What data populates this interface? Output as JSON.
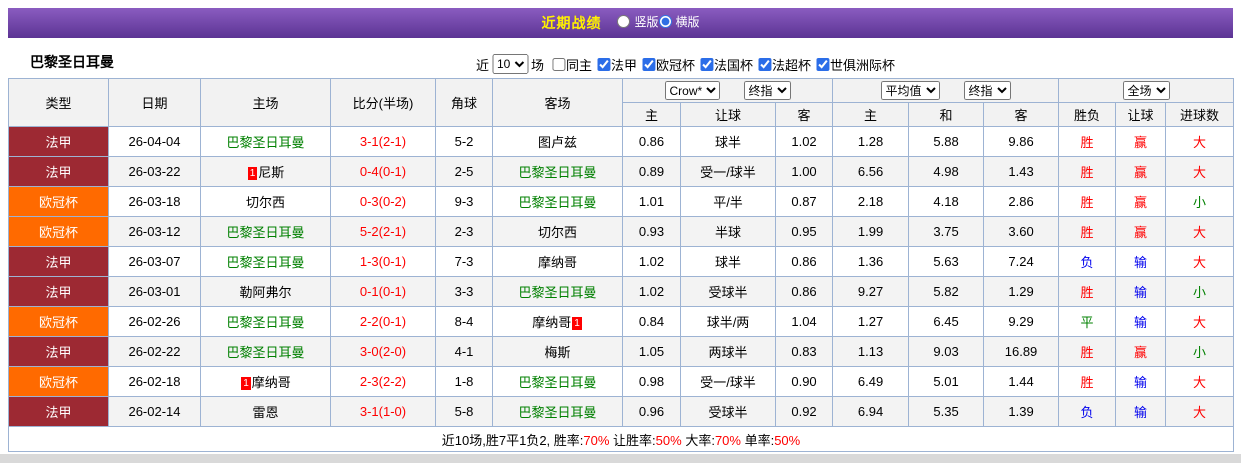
{
  "colors": {
    "title_bar_purple": "#6a3fa0",
    "title_text_yellow": "#fff100",
    "ligue1_red": "#9d2933",
    "ucl_orange": "#ff6a00",
    "psg_green": "#008000",
    "win_red": "#ff0000",
    "lose_blue": "#0000ee",
    "draw_green": "#008000",
    "table_border_blue": "#9db3d3"
  },
  "title_bar": {
    "title": "近期战绩",
    "layout_options": [
      {
        "key": "vertical",
        "label": "竖版",
        "selected": false
      },
      {
        "key": "horizontal",
        "label": "横版",
        "selected": true
      }
    ]
  },
  "filter_bar": {
    "team_name": "巴黎圣日耳曼",
    "near_label": "近",
    "match_count": "10",
    "matches_label": "场",
    "checkboxes": [
      {
        "key": "same-home",
        "label": "同主",
        "checked": false
      },
      {
        "key": "ligue1",
        "label": "法甲",
        "checked": true
      },
      {
        "key": "ucl",
        "label": "欧冠杯",
        "checked": true
      },
      {
        "key": "coupe-de-france",
        "label": "法国杯",
        "checked": true
      },
      {
        "key": "trophee",
        "label": "法超杯",
        "checked": true
      },
      {
        "key": "club-world-cup",
        "label": "世俱洲际杯",
        "checked": true
      }
    ]
  },
  "table": {
    "main_headers": [
      "类型",
      "日期",
      "主场",
      "比分(半场)",
      "角球",
      "客场"
    ],
    "sub_headers": [
      "主",
      "让球",
      "客",
      "主",
      "和",
      "客",
      "胜负",
      "让球",
      "进球数"
    ],
    "selects": {
      "odds_source": "Crow*",
      "odds_time": "终指",
      "avg_source": "平均值",
      "avg_time": "终指",
      "result_scope": "全场"
    },
    "redcard_label": "1",
    "rows": [
      {
        "league": "法甲",
        "league_type": "ligue1",
        "date": "26-04-04",
        "home": {
          "name": "巴黎圣日耳曼",
          "psg": true
        },
        "score": "3-1(2-1)",
        "corners": "5-2",
        "away": {
          "name": "图卢兹",
          "psg": false
        },
        "crown_home": "0.86",
        "crown_hcap": "球半",
        "crown_away": "1.02",
        "avg_home": "1.28",
        "avg_draw": "5.88",
        "avg_away": "9.86",
        "wdl": {
          "t": "胜",
          "c": "red"
        },
        "hcap_res": {
          "t": "赢",
          "c": "red"
        },
        "goals": {
          "t": "大",
          "c": "red"
        }
      },
      {
        "league": "法甲",
        "league_type": "ligue1",
        "date": "26-03-22",
        "home": {
          "name": "尼斯",
          "psg": false,
          "redcard": "before"
        },
        "score": "0-4(0-1)",
        "corners": "2-5",
        "away": {
          "name": "巴黎圣日耳曼",
          "psg": true
        },
        "crown_home": "0.89",
        "crown_hcap": "受一/球半",
        "crown_away": "1.00",
        "avg_home": "6.56",
        "avg_draw": "4.98",
        "avg_away": "1.43",
        "wdl": {
          "t": "胜",
          "c": "red"
        },
        "hcap_res": {
          "t": "赢",
          "c": "red"
        },
        "goals": {
          "t": "大",
          "c": "red"
        }
      },
      {
        "league": "欧冠杯",
        "league_type": "ucl",
        "date": "26-03-18",
        "home": {
          "name": "切尔西",
          "psg": false
        },
        "score": "0-3(0-2)",
        "corners": "9-3",
        "away": {
          "name": "巴黎圣日耳曼",
          "psg": true
        },
        "crown_home": "1.01",
        "crown_hcap": "平/半",
        "crown_away": "0.87",
        "avg_home": "2.18",
        "avg_draw": "4.18",
        "avg_away": "2.86",
        "wdl": {
          "t": "胜",
          "c": "red"
        },
        "hcap_res": {
          "t": "赢",
          "c": "red"
        },
        "goals": {
          "t": "小",
          "c": "green"
        }
      },
      {
        "league": "欧冠杯",
        "league_type": "ucl",
        "date": "26-03-12",
        "home": {
          "name": "巴黎圣日耳曼",
          "psg": true
        },
        "score": "5-2(2-1)",
        "corners": "2-3",
        "away": {
          "name": "切尔西",
          "psg": false
        },
        "crown_home": "0.93",
        "crown_hcap": "半球",
        "crown_away": "0.95",
        "avg_home": "1.99",
        "avg_draw": "3.75",
        "avg_away": "3.60",
        "wdl": {
          "t": "胜",
          "c": "red"
        },
        "hcap_res": {
          "t": "赢",
          "c": "red"
        },
        "goals": {
          "t": "大",
          "c": "red"
        }
      },
      {
        "league": "法甲",
        "league_type": "ligue1",
        "date": "26-03-07",
        "home": {
          "name": "巴黎圣日耳曼",
          "psg": true
        },
        "score": "1-3(0-1)",
        "corners": "7-3",
        "away": {
          "name": "摩纳哥",
          "psg": false
        },
        "crown_home": "1.02",
        "crown_hcap": "球半",
        "crown_away": "0.86",
        "avg_home": "1.36",
        "avg_draw": "5.63",
        "avg_away": "7.24",
        "wdl": {
          "t": "负",
          "c": "blue"
        },
        "hcap_res": {
          "t": "输",
          "c": "blue"
        },
        "goals": {
          "t": "大",
          "c": "red"
        }
      },
      {
        "league": "法甲",
        "league_type": "ligue1",
        "date": "26-03-01",
        "home": {
          "name": "勒阿弗尔",
          "psg": false
        },
        "score": "0-1(0-1)",
        "corners": "3-3",
        "away": {
          "name": "巴黎圣日耳曼",
          "psg": true
        },
        "crown_home": "1.02",
        "crown_hcap": "受球半",
        "crown_away": "0.86",
        "avg_home": "9.27",
        "avg_draw": "5.82",
        "avg_away": "1.29",
        "wdl": {
          "t": "胜",
          "c": "red"
        },
        "hcap_res": {
          "t": "输",
          "c": "blue"
        },
        "goals": {
          "t": "小",
          "c": "green"
        }
      },
      {
        "league": "欧冠杯",
        "league_type": "ucl",
        "date": "26-02-26",
        "home": {
          "name": "巴黎圣日耳曼",
          "psg": true
        },
        "score": "2-2(0-1)",
        "corners": "8-4",
        "away": {
          "name": "摩纳哥",
          "psg": false,
          "redcard": "after"
        },
        "crown_home": "0.84",
        "crown_hcap": "球半/两",
        "crown_away": "1.04",
        "avg_home": "1.27",
        "avg_draw": "6.45",
        "avg_away": "9.29",
        "wdl": {
          "t": "平",
          "c": "green"
        },
        "hcap_res": {
          "t": "输",
          "c": "blue"
        },
        "goals": {
          "t": "大",
          "c": "red"
        }
      },
      {
        "league": "法甲",
        "league_type": "ligue1",
        "date": "26-02-22",
        "home": {
          "name": "巴黎圣日耳曼",
          "psg": true
        },
        "score": "3-0(2-0)",
        "corners": "4-1",
        "away": {
          "name": "梅斯",
          "psg": false
        },
        "crown_home": "1.05",
        "crown_hcap": "两球半",
        "crown_away": "0.83",
        "avg_home": "1.13",
        "avg_draw": "9.03",
        "avg_away": "16.89",
        "wdl": {
          "t": "胜",
          "c": "red"
        },
        "hcap_res": {
          "t": "赢",
          "c": "red"
        },
        "goals": {
          "t": "小",
          "c": "green"
        }
      },
      {
        "league": "欧冠杯",
        "league_type": "ucl",
        "date": "26-02-18",
        "home": {
          "name": "摩纳哥",
          "psg": false,
          "redcard": "before"
        },
        "score": "2-3(2-2)",
        "corners": "1-8",
        "away": {
          "name": "巴黎圣日耳曼",
          "psg": true
        },
        "crown_home": "0.98",
        "crown_hcap": "受一/球半",
        "crown_away": "0.90",
        "avg_home": "6.49",
        "avg_draw": "5.01",
        "avg_away": "1.44",
        "wdl": {
          "t": "胜",
          "c": "red"
        },
        "hcap_res": {
          "t": "输",
          "c": "blue"
        },
        "goals": {
          "t": "大",
          "c": "red"
        }
      },
      {
        "league": "法甲",
        "league_type": "ligue1",
        "date": "26-02-14",
        "home": {
          "name": "雷恩",
          "psg": false
        },
        "score": "3-1(1-0)",
        "corners": "5-8",
        "away": {
          "name": "巴黎圣日耳曼",
          "psg": true
        },
        "crown_home": "0.96",
        "crown_hcap": "受球半",
        "crown_away": "0.92",
        "avg_home": "6.94",
        "avg_draw": "5.35",
        "avg_away": "1.39",
        "wdl": {
          "t": "负",
          "c": "blue"
        },
        "hcap_res": {
          "t": "输",
          "c": "blue"
        },
        "goals": {
          "t": "大",
          "c": "red"
        }
      }
    ]
  },
  "summary": {
    "parts": [
      {
        "text": "近10场,胜7平1负2, 胜率:",
        "red": false
      },
      {
        "text": "70%",
        "red": true
      },
      {
        "text": " 让胜率:",
        "red": false
      },
      {
        "text": "50%",
        "red": true
      },
      {
        "text": " 大率:",
        "red": false
      },
      {
        "text": "70%",
        "red": true
      },
      {
        "text": " 单率:",
        "red": false
      },
      {
        "text": "50%",
        "red": true
      }
    ]
  }
}
